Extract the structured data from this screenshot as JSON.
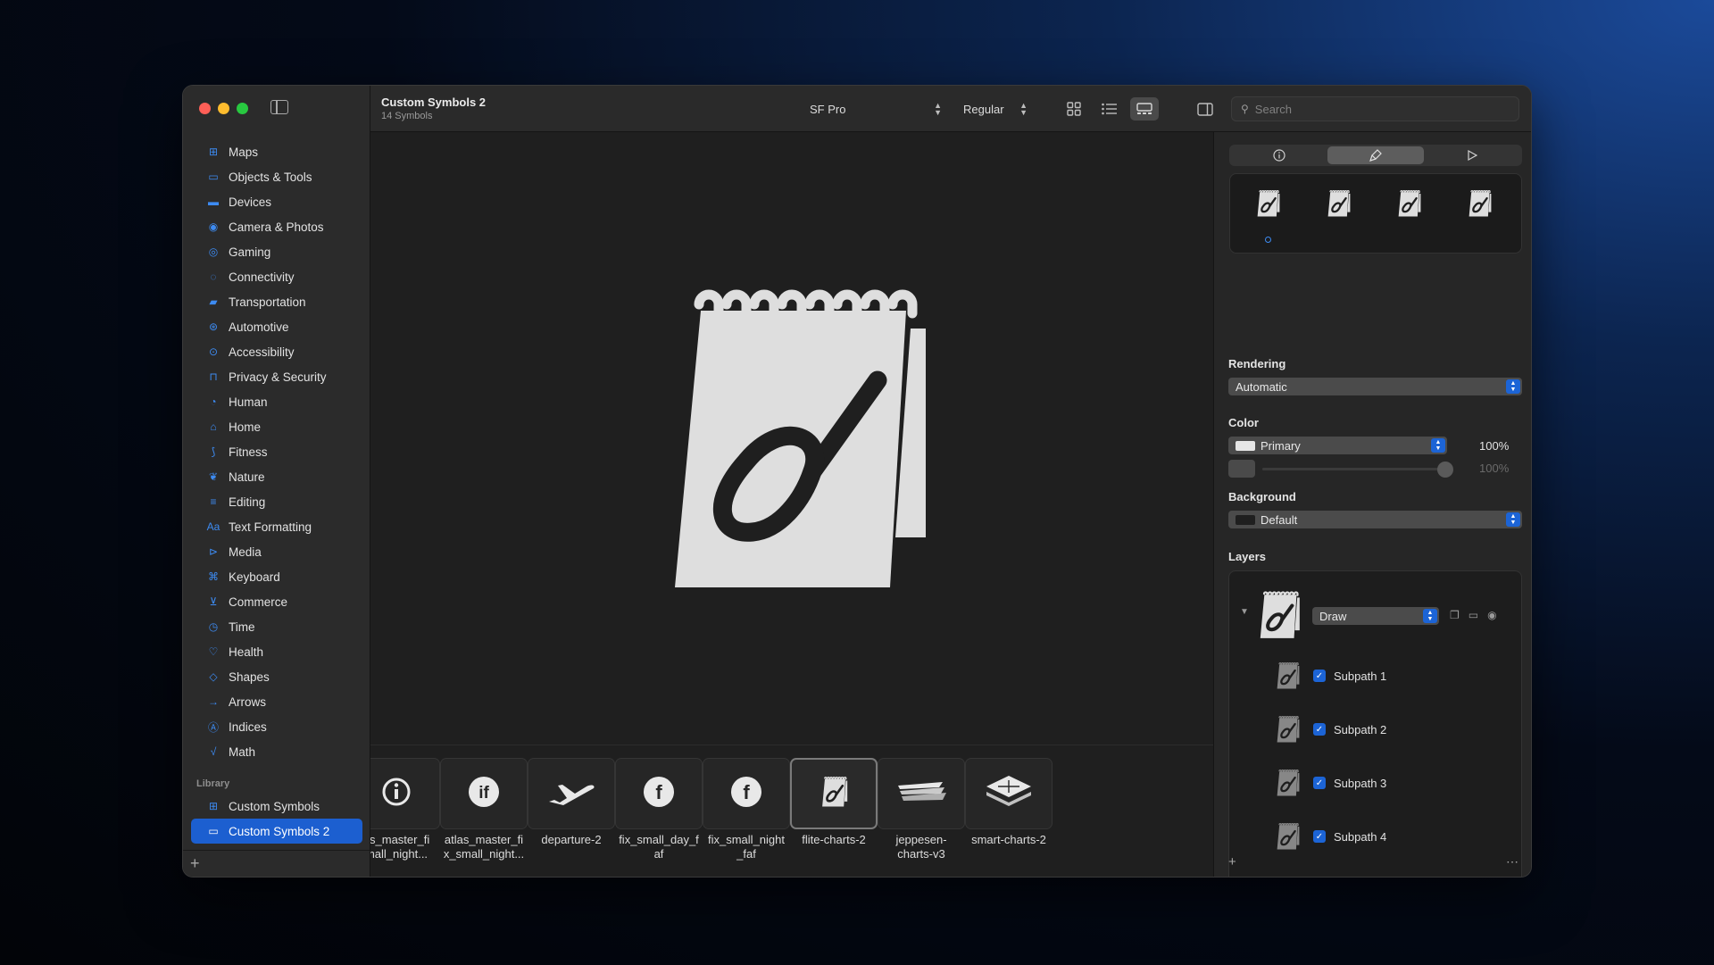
{
  "window": {
    "title": "Custom Symbols 2",
    "subtitle": "14 Symbols"
  },
  "toolbar": {
    "font": "SF Pro",
    "weight": "Regular",
    "search_placeholder": "Search"
  },
  "sidebar": {
    "categories": [
      {
        "label": "Maps",
        "icon": "map-icon"
      },
      {
        "label": "Objects & Tools",
        "icon": "folder-icon"
      },
      {
        "label": "Devices",
        "icon": "display-icon"
      },
      {
        "label": "Camera & Photos",
        "icon": "camera-icon"
      },
      {
        "label": "Gaming",
        "icon": "gamecontroller-icon"
      },
      {
        "label": "Connectivity",
        "icon": "antenna-icon"
      },
      {
        "label": "Transportation",
        "icon": "car-icon"
      },
      {
        "label": "Automotive",
        "icon": "steering-wheel-icon"
      },
      {
        "label": "Accessibility",
        "icon": "accessibility-icon"
      },
      {
        "label": "Privacy & Security",
        "icon": "lock-icon"
      },
      {
        "label": "Human",
        "icon": "person-icon"
      },
      {
        "label": "Home",
        "icon": "house-icon"
      },
      {
        "label": "Fitness",
        "icon": "figure-run-icon"
      },
      {
        "label": "Nature",
        "icon": "leaf-icon"
      },
      {
        "label": "Editing",
        "icon": "sliders-icon"
      },
      {
        "label": "Text Formatting",
        "icon": "textformat-icon"
      },
      {
        "label": "Media",
        "icon": "play-pause-icon"
      },
      {
        "label": "Keyboard",
        "icon": "command-icon"
      },
      {
        "label": "Commerce",
        "icon": "cart-icon"
      },
      {
        "label": "Time",
        "icon": "clock-icon"
      },
      {
        "label": "Health",
        "icon": "heart-icon"
      },
      {
        "label": "Shapes",
        "icon": "shapes-icon"
      },
      {
        "label": "Arrows",
        "icon": "arrow-right-icon"
      },
      {
        "label": "Indices",
        "icon": "a-circle-icon"
      },
      {
        "label": "Math",
        "icon": "sqrt-icon"
      }
    ],
    "library_heading": "Library",
    "library": [
      {
        "label": "Custom Symbols",
        "icon": "grid-icon",
        "selected": false
      },
      {
        "label": "Custom Symbols 2",
        "icon": "folder-icon",
        "selected": true
      }
    ],
    "add_label": "+"
  },
  "strip": {
    "items": [
      {
        "line1": "as_master_fi",
        "line2": "mall_night...",
        "icon": "info-circle-icon"
      },
      {
        "line1": "atlas_master_fi",
        "line2": "x_small_night...",
        "icon": "if-circle-icon"
      },
      {
        "line1": "departure-2",
        "line2": "",
        "icon": "airplane-departure-icon"
      },
      {
        "line1": "fix_small_day_f",
        "line2": "af",
        "icon": "f-circle-icon"
      },
      {
        "line1": "fix_small_night",
        "line2": "_faf",
        "icon": "f-circle-icon"
      },
      {
        "line1": "flite-charts-2",
        "line2": "",
        "icon": "notepad-pen-icon",
        "selected": true
      },
      {
        "line1": "jeppesen-",
        "line2": "charts-v3",
        "icon": "stacked-charts-icon"
      },
      {
        "line1": "smart-charts-2",
        "line2": "",
        "icon": "layered-map-icon"
      }
    ]
  },
  "inspector": {
    "tabs": [
      "info-icon",
      "paintbrush-icon",
      "play-icon"
    ],
    "rendering_label": "Rendering",
    "rendering_value": "Automatic",
    "color_label": "Color",
    "color_value": "Primary",
    "color_opacity": "100%",
    "secondary_opacity": "100%",
    "background_label": "Background",
    "background_value": "Default",
    "layers_label": "Layers",
    "layer_name": "Draw",
    "subpaths": [
      "Subpath 1",
      "Subpath 2",
      "Subpath 3",
      "Subpath 4"
    ],
    "add_label": "+",
    "more_label": "⋯"
  },
  "colors": {
    "accent": "#1c64d6",
    "sidebar_icon": "#3d8bf2",
    "symbol_fill": "#dedede"
  }
}
